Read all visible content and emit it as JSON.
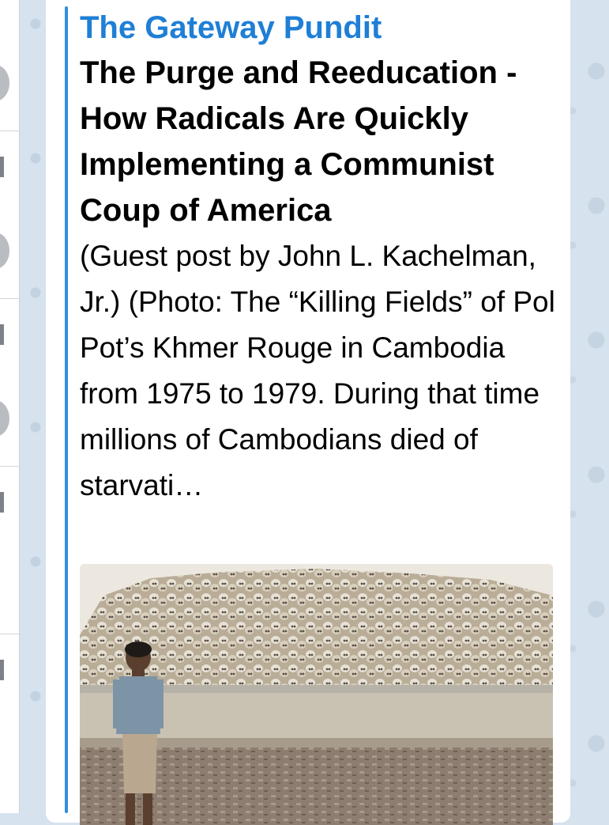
{
  "link_preview": {
    "site_name": "The Gateway Pundit",
    "title": "The Purge and Reeducation - How Radicals Are Quickly Implementing a Communist Coup of America",
    "description": "(Guest post by John L. Kachelman, Jr.) (Photo: The “Killing Fields” of Pol Pot’s Khmer Rouge in Cambodia from 1975 to 1979. During that time millions of Cambodians died of starvati…",
    "image_subject": "pile of skulls behind a low wall with a young boy standing in the foreground",
    "accent_color": "#2f8fe0",
    "site_name_color": "#1f7fd6"
  }
}
